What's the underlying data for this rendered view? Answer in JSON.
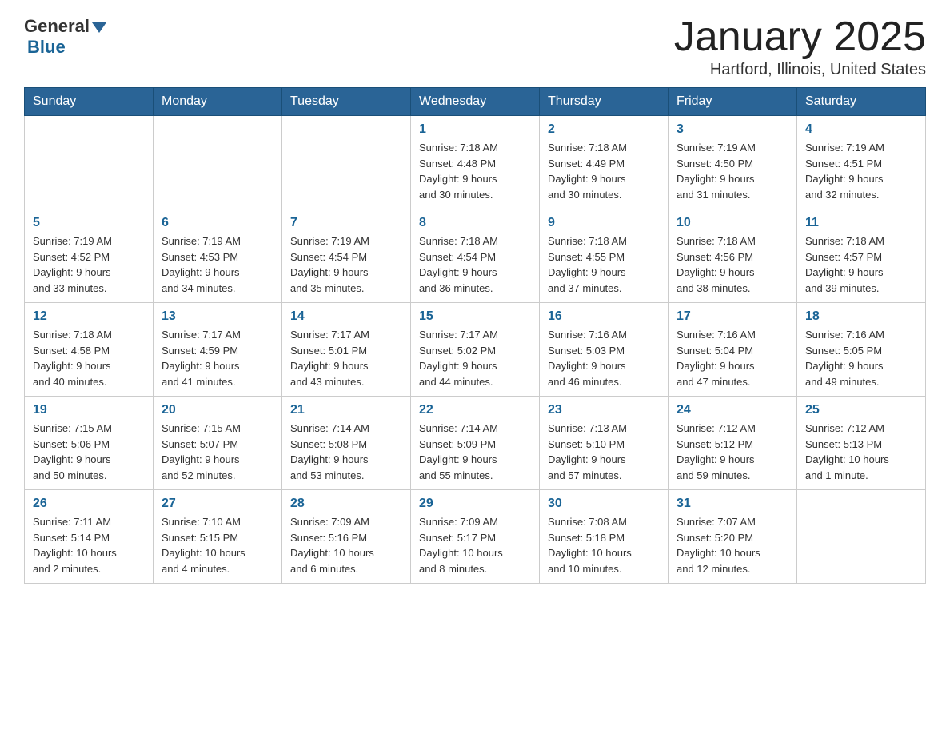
{
  "logo": {
    "general": "General",
    "blue": "Blue"
  },
  "title": "January 2025",
  "location": "Hartford, Illinois, United States",
  "days_of_week": [
    "Sunday",
    "Monday",
    "Tuesday",
    "Wednesday",
    "Thursday",
    "Friday",
    "Saturday"
  ],
  "weeks": [
    [
      {
        "day": "",
        "info": ""
      },
      {
        "day": "",
        "info": ""
      },
      {
        "day": "",
        "info": ""
      },
      {
        "day": "1",
        "info": "Sunrise: 7:18 AM\nSunset: 4:48 PM\nDaylight: 9 hours\nand 30 minutes."
      },
      {
        "day": "2",
        "info": "Sunrise: 7:18 AM\nSunset: 4:49 PM\nDaylight: 9 hours\nand 30 minutes."
      },
      {
        "day": "3",
        "info": "Sunrise: 7:19 AM\nSunset: 4:50 PM\nDaylight: 9 hours\nand 31 minutes."
      },
      {
        "day": "4",
        "info": "Sunrise: 7:19 AM\nSunset: 4:51 PM\nDaylight: 9 hours\nand 32 minutes."
      }
    ],
    [
      {
        "day": "5",
        "info": "Sunrise: 7:19 AM\nSunset: 4:52 PM\nDaylight: 9 hours\nand 33 minutes."
      },
      {
        "day": "6",
        "info": "Sunrise: 7:19 AM\nSunset: 4:53 PM\nDaylight: 9 hours\nand 34 minutes."
      },
      {
        "day": "7",
        "info": "Sunrise: 7:19 AM\nSunset: 4:54 PM\nDaylight: 9 hours\nand 35 minutes."
      },
      {
        "day": "8",
        "info": "Sunrise: 7:18 AM\nSunset: 4:54 PM\nDaylight: 9 hours\nand 36 minutes."
      },
      {
        "day": "9",
        "info": "Sunrise: 7:18 AM\nSunset: 4:55 PM\nDaylight: 9 hours\nand 37 minutes."
      },
      {
        "day": "10",
        "info": "Sunrise: 7:18 AM\nSunset: 4:56 PM\nDaylight: 9 hours\nand 38 minutes."
      },
      {
        "day": "11",
        "info": "Sunrise: 7:18 AM\nSunset: 4:57 PM\nDaylight: 9 hours\nand 39 minutes."
      }
    ],
    [
      {
        "day": "12",
        "info": "Sunrise: 7:18 AM\nSunset: 4:58 PM\nDaylight: 9 hours\nand 40 minutes."
      },
      {
        "day": "13",
        "info": "Sunrise: 7:17 AM\nSunset: 4:59 PM\nDaylight: 9 hours\nand 41 minutes."
      },
      {
        "day": "14",
        "info": "Sunrise: 7:17 AM\nSunset: 5:01 PM\nDaylight: 9 hours\nand 43 minutes."
      },
      {
        "day": "15",
        "info": "Sunrise: 7:17 AM\nSunset: 5:02 PM\nDaylight: 9 hours\nand 44 minutes."
      },
      {
        "day": "16",
        "info": "Sunrise: 7:16 AM\nSunset: 5:03 PM\nDaylight: 9 hours\nand 46 minutes."
      },
      {
        "day": "17",
        "info": "Sunrise: 7:16 AM\nSunset: 5:04 PM\nDaylight: 9 hours\nand 47 minutes."
      },
      {
        "day": "18",
        "info": "Sunrise: 7:16 AM\nSunset: 5:05 PM\nDaylight: 9 hours\nand 49 minutes."
      }
    ],
    [
      {
        "day": "19",
        "info": "Sunrise: 7:15 AM\nSunset: 5:06 PM\nDaylight: 9 hours\nand 50 minutes."
      },
      {
        "day": "20",
        "info": "Sunrise: 7:15 AM\nSunset: 5:07 PM\nDaylight: 9 hours\nand 52 minutes."
      },
      {
        "day": "21",
        "info": "Sunrise: 7:14 AM\nSunset: 5:08 PM\nDaylight: 9 hours\nand 53 minutes."
      },
      {
        "day": "22",
        "info": "Sunrise: 7:14 AM\nSunset: 5:09 PM\nDaylight: 9 hours\nand 55 minutes."
      },
      {
        "day": "23",
        "info": "Sunrise: 7:13 AM\nSunset: 5:10 PM\nDaylight: 9 hours\nand 57 minutes."
      },
      {
        "day": "24",
        "info": "Sunrise: 7:12 AM\nSunset: 5:12 PM\nDaylight: 9 hours\nand 59 minutes."
      },
      {
        "day": "25",
        "info": "Sunrise: 7:12 AM\nSunset: 5:13 PM\nDaylight: 10 hours\nand 1 minute."
      }
    ],
    [
      {
        "day": "26",
        "info": "Sunrise: 7:11 AM\nSunset: 5:14 PM\nDaylight: 10 hours\nand 2 minutes."
      },
      {
        "day": "27",
        "info": "Sunrise: 7:10 AM\nSunset: 5:15 PM\nDaylight: 10 hours\nand 4 minutes."
      },
      {
        "day": "28",
        "info": "Sunrise: 7:09 AM\nSunset: 5:16 PM\nDaylight: 10 hours\nand 6 minutes."
      },
      {
        "day": "29",
        "info": "Sunrise: 7:09 AM\nSunset: 5:17 PM\nDaylight: 10 hours\nand 8 minutes."
      },
      {
        "day": "30",
        "info": "Sunrise: 7:08 AM\nSunset: 5:18 PM\nDaylight: 10 hours\nand 10 minutes."
      },
      {
        "day": "31",
        "info": "Sunrise: 7:07 AM\nSunset: 5:20 PM\nDaylight: 10 hours\nand 12 minutes."
      },
      {
        "day": "",
        "info": ""
      }
    ]
  ]
}
